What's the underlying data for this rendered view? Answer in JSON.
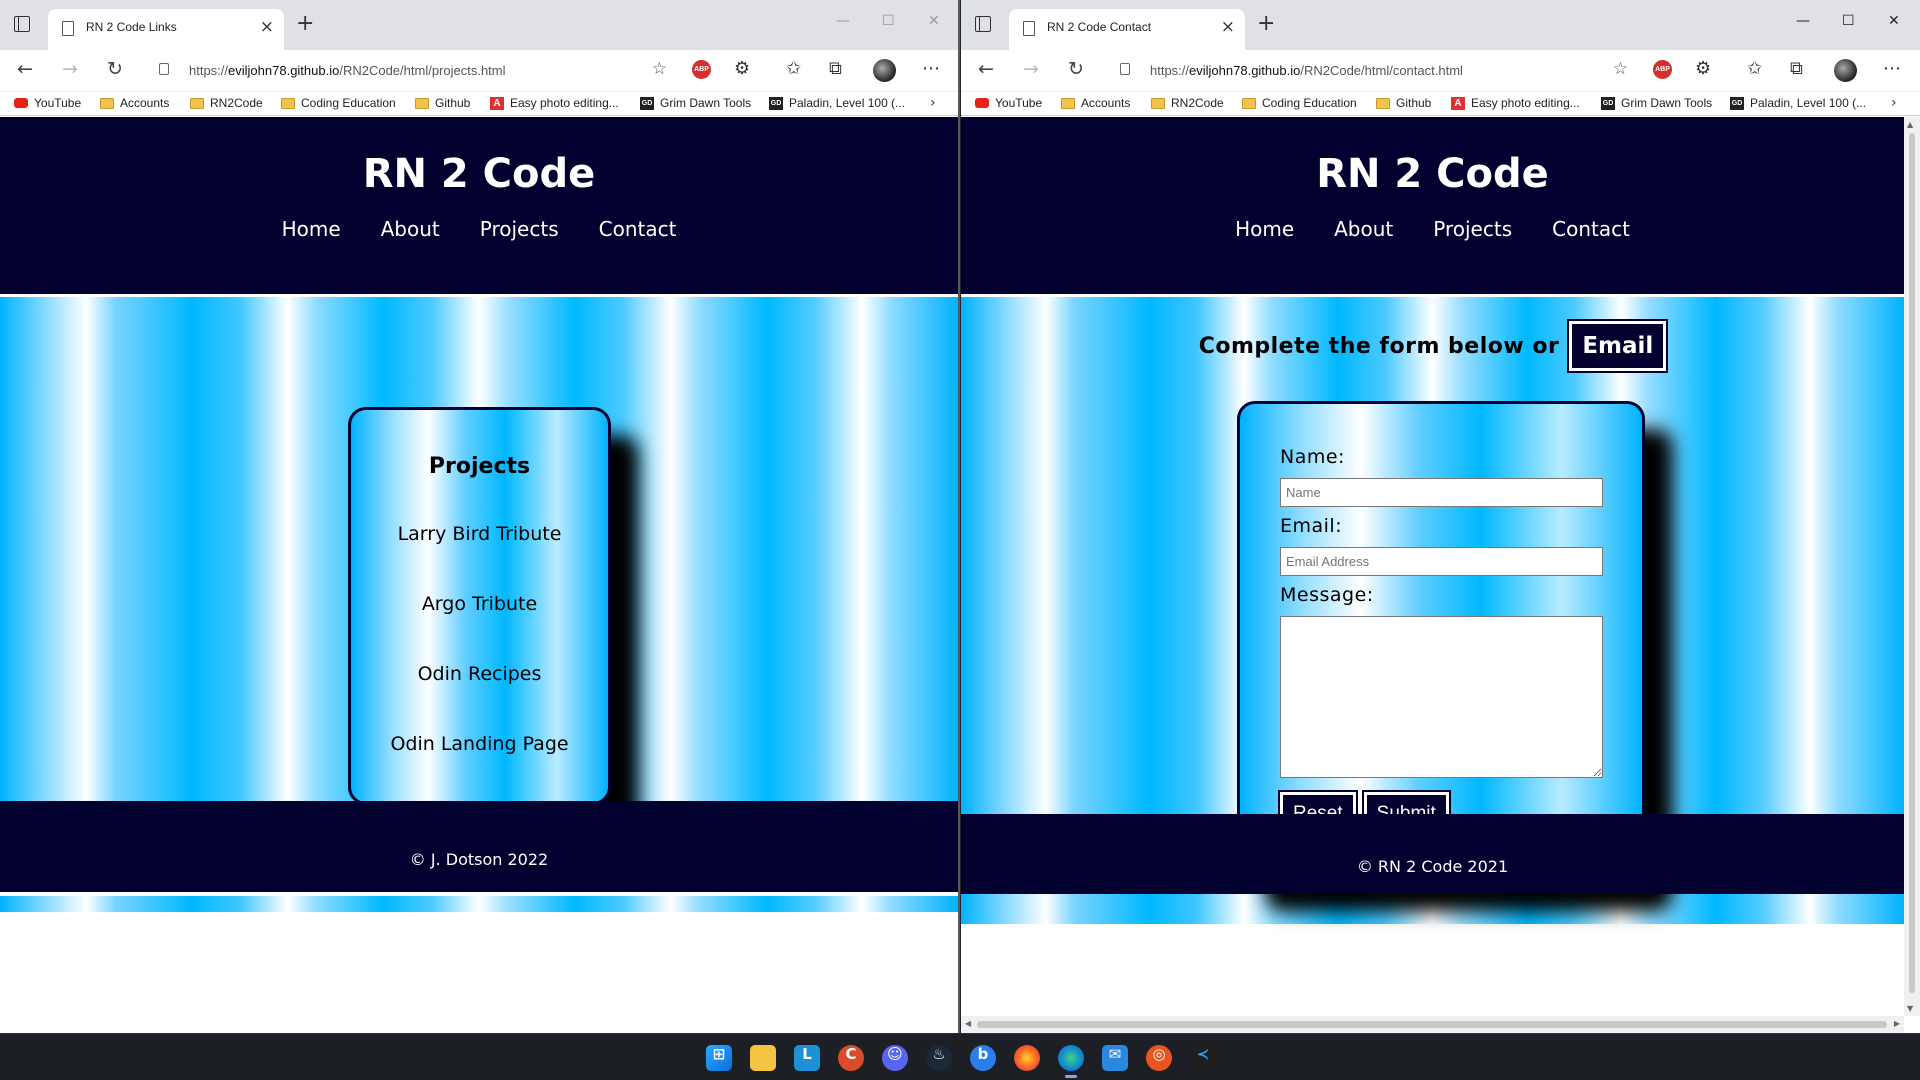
{
  "left_window": {
    "tab_title": "RN 2 Code Links",
    "url_prefix": "https://",
    "url_host": "eviljohn78.github.io",
    "url_path": "/RN2Code/html/projects.html",
    "site_title": "RN 2 Code",
    "nav": [
      "Home",
      "About",
      "Projects",
      "Contact"
    ],
    "card_heading": "Projects",
    "projects": [
      "Larry Bird Tribute",
      "Argo Tribute",
      "Odin Recipes",
      "Odin Landing Page"
    ],
    "footer": "© J. Dotson 2022"
  },
  "right_window": {
    "tab_title": "RN 2 Code Contact",
    "url_prefix": "https://",
    "url_host": "eviljohn78.github.io",
    "url_path": "/RN2Code/html/contact.html",
    "site_title": "RN 2 Code",
    "nav": [
      "Home",
      "About",
      "Projects",
      "Contact"
    ],
    "lead_text": "Complete the form below or",
    "email_button": "Email",
    "form": {
      "name_label": "Name:",
      "name_placeholder": "Name",
      "email_label": "Email:",
      "email_placeholder": "Email Address",
      "message_label": "Message:",
      "reset_label": "Reset",
      "submit_label": "Submit"
    },
    "footer": "© RN 2 Code 2021"
  },
  "bookmarks": [
    "YouTube",
    "Accounts",
    "RN2Code",
    "Coding Education",
    "Github",
    "Easy photo editing...",
    "Grim Dawn Tools",
    "Paladin, Level 100 (..."
  ],
  "bookmark_icons": [
    "youtube-icon",
    "folder-icon",
    "folder-icon",
    "folder-icon",
    "folder-icon",
    "adobe-icon",
    "grim-dawn-icon",
    "grim-dawn-icon"
  ],
  "colors": {
    "navy": "#01002e",
    "accent_blue": "#00b8ff"
  },
  "taskbar_icons": [
    "windows-start-icon",
    "file-explorer-icon",
    "l-app-icon",
    "ccleaner-icon",
    "discord-icon",
    "steam-icon",
    "bing-icon",
    "firefox-icon",
    "edge-icon",
    "mail-icon",
    "ubuntu-icon",
    "vscode-icon"
  ]
}
